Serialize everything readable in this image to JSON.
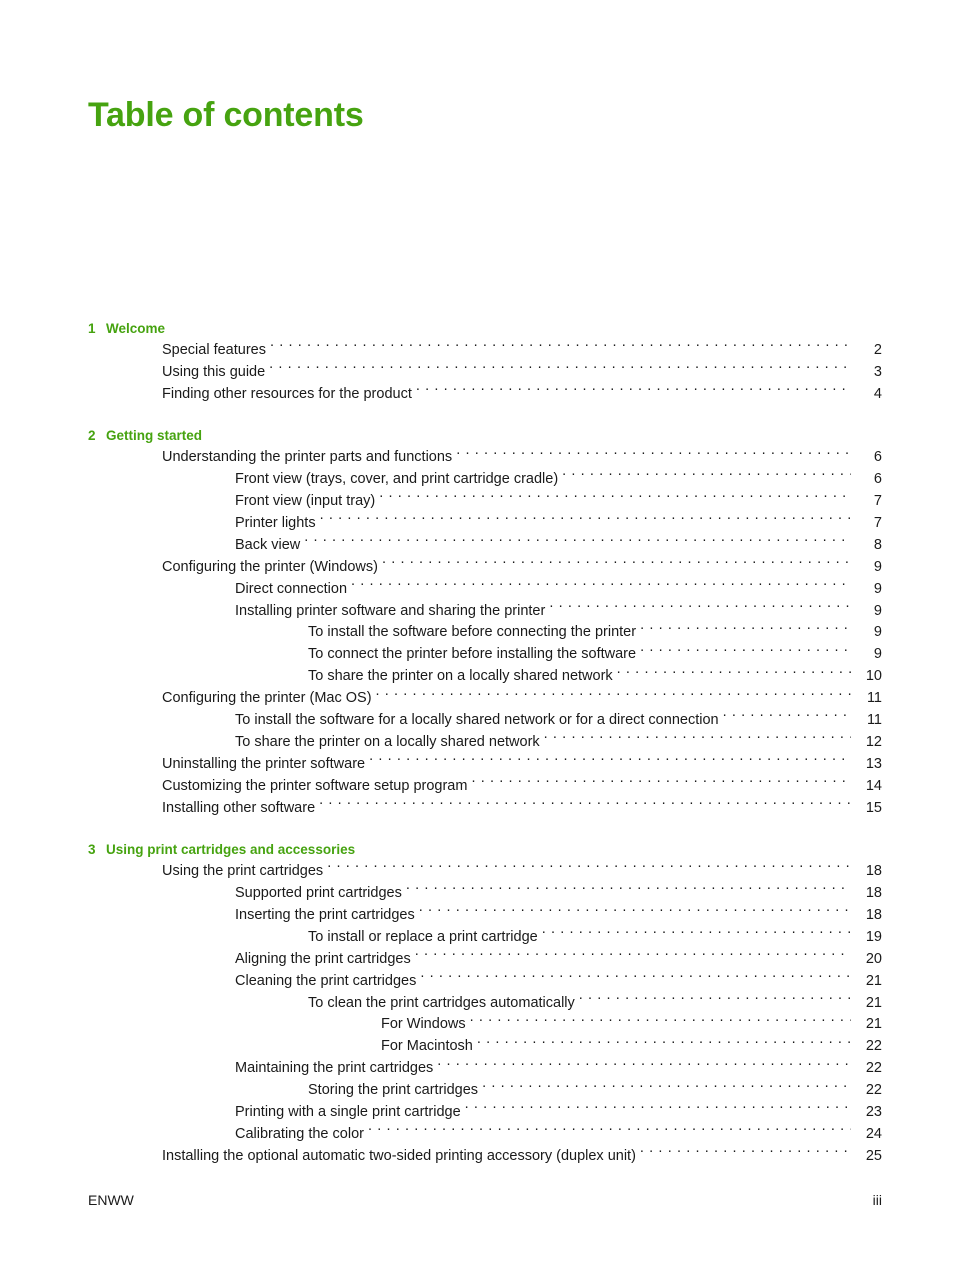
{
  "document": {
    "title": "Table of contents",
    "title_color": "#46a310"
  },
  "footer": {
    "left": "ENWW",
    "right": "iii"
  },
  "toc": {
    "chapters": [
      {
        "number": "1",
        "title": "Welcome",
        "entries": [
          {
            "level": 1,
            "label": "Special features",
            "page": "2"
          },
          {
            "level": 1,
            "label": "Using this guide",
            "page": "3"
          },
          {
            "level": 1,
            "label": "Finding other resources for the product",
            "page": "4"
          }
        ]
      },
      {
        "number": "2",
        "title": "Getting started",
        "entries": [
          {
            "level": 1,
            "label": "Understanding the printer parts and functions",
            "page": "6"
          },
          {
            "level": 2,
            "label": "Front view (trays, cover, and print cartridge cradle)",
            "page": "6"
          },
          {
            "level": 2,
            "label": "Front view (input tray)",
            "page": "7"
          },
          {
            "level": 2,
            "label": "Printer lights",
            "page": "7"
          },
          {
            "level": 2,
            "label": "Back view",
            "page": "8"
          },
          {
            "level": 1,
            "label": "Configuring the printer (Windows)",
            "page": "9"
          },
          {
            "level": 2,
            "label": "Direct connection",
            "page": "9"
          },
          {
            "level": 2,
            "label": "Installing printer software and sharing the printer",
            "page": "9"
          },
          {
            "level": 3,
            "label": "To install the software before connecting the printer",
            "page": "9"
          },
          {
            "level": 3,
            "label": "To connect the printer before installing the software",
            "page": "9"
          },
          {
            "level": 3,
            "label": "To share the printer on a locally shared network",
            "page": "10"
          },
          {
            "level": 1,
            "label": "Configuring the printer (Mac OS)",
            "page": "11"
          },
          {
            "level": 2,
            "label": "To install the software for a locally shared network or for a direct connection",
            "page": "11"
          },
          {
            "level": 2,
            "label": "To share the printer on a locally shared network",
            "page": "12"
          },
          {
            "level": 1,
            "label": "Uninstalling the printer software",
            "page": "13"
          },
          {
            "level": 1,
            "label": "Customizing the printer software setup program",
            "page": "14"
          },
          {
            "level": 1,
            "label": "Installing other software",
            "page": "15"
          }
        ]
      },
      {
        "number": "3",
        "title": "Using print cartridges and accessories",
        "entries": [
          {
            "level": 1,
            "label": "Using the print cartridges",
            "page": "18"
          },
          {
            "level": 2,
            "label": "Supported print cartridges",
            "page": "18"
          },
          {
            "level": 2,
            "label": "Inserting the print cartridges",
            "page": "18"
          },
          {
            "level": 3,
            "label": "To install or replace a print cartridge",
            "page": "19"
          },
          {
            "level": 2,
            "label": "Aligning the print cartridges",
            "page": "20"
          },
          {
            "level": 2,
            "label": "Cleaning the print cartridges",
            "page": "21"
          },
          {
            "level": 3,
            "label": "To clean the print cartridges automatically",
            "page": "21"
          },
          {
            "level": 4,
            "label": "For Windows",
            "page": "21"
          },
          {
            "level": 4,
            "label": "For Macintosh",
            "page": "22"
          },
          {
            "level": 2,
            "label": "Maintaining the print cartridges",
            "page": "22"
          },
          {
            "level": 3,
            "label": "Storing the print cartridges",
            "page": "22"
          },
          {
            "level": 2,
            "label": "Printing with a single print cartridge",
            "page": "23"
          },
          {
            "level": 2,
            "label": "Calibrating the color",
            "page": "24"
          },
          {
            "level": 1,
            "label": "Installing the optional automatic two-sided printing accessory (duplex unit)",
            "page": "25"
          }
        ]
      }
    ]
  }
}
